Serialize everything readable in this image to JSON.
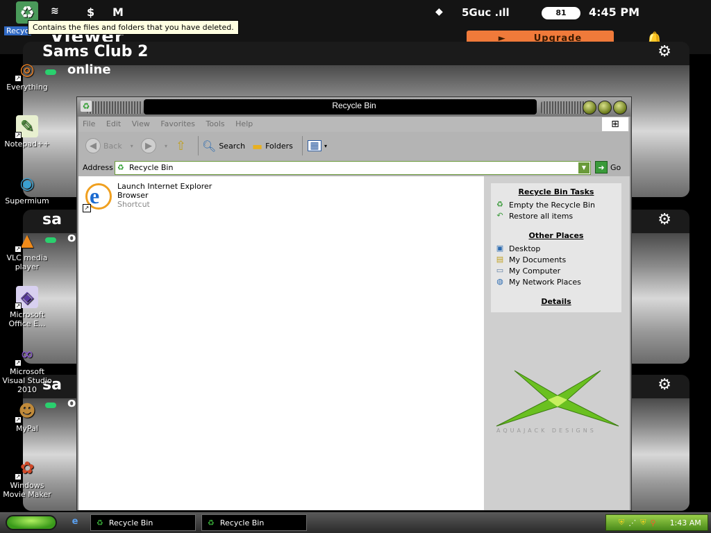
{
  "phone": {
    "status": {
      "time": "4:45 PM",
      "network": "5Guc .ıll",
      "battery": "81"
    },
    "app_title": "Viewer",
    "upgrade_label": "Upgrade",
    "cameras": [
      {
        "name": "Sams Club 2",
        "status": "online"
      },
      {
        "name": "sa",
        "status": "o"
      },
      {
        "name": "sa",
        "status": "o"
      }
    ]
  },
  "desktop": {
    "icons": [
      {
        "label": "Recycle Bin",
        "icon": "recycle-bin-icon"
      },
      {
        "label": "Everything",
        "icon": "everything-icon"
      },
      {
        "label": "Notepad++",
        "icon": "notepad-plus-plus-icon"
      },
      {
        "label": "Supermium",
        "icon": "supermium-icon"
      },
      {
        "label": "VLC media player",
        "icon": "vlc-icon"
      },
      {
        "label": "Microsoft Office E...",
        "icon": "office-icon"
      },
      {
        "label": "Microsoft Visual Studio 2010",
        "icon": "visual-studio-icon"
      },
      {
        "label": "MyPal",
        "icon": "mypal-icon"
      },
      {
        "label": "Windows Movie Maker",
        "icon": "movie-maker-icon"
      }
    ],
    "recycle_partial_label": "Recyc",
    "tooltip": "Contains the files and folders that you have deleted."
  },
  "window": {
    "title": "Recycle Bin",
    "menu": [
      "File",
      "Edit",
      "View",
      "Favorites",
      "Tools",
      "Help"
    ],
    "toolbar": {
      "back": "Back",
      "search": "Search",
      "folders": "Folders"
    },
    "address": {
      "label": "Address",
      "value": "Recycle Bin",
      "go": "Go"
    },
    "file": {
      "name_line1": "Launch Internet Explorer",
      "name_line2": "Browser",
      "type": "Shortcut"
    },
    "taskpane": {
      "tasks_heading": "Recycle Bin Tasks",
      "tasks": [
        "Empty the Recycle Bin",
        "Restore all items"
      ],
      "places_heading": "Other Places",
      "places": [
        "Desktop",
        "My Documents",
        "My Computer",
        "My Network Places"
      ],
      "details_heading": "Details",
      "brand": "AQUAJACK DESIGNS"
    }
  },
  "taskbar": {
    "buttons": [
      "Recycle Bin",
      "Recycle Bin"
    ],
    "clock": "1:43 AM"
  },
  "colors": {
    "upgrade": "#f07a3a",
    "online": "#2ad06e",
    "tray": "#6aaa2a",
    "accent_green": "#3a9a3a"
  }
}
